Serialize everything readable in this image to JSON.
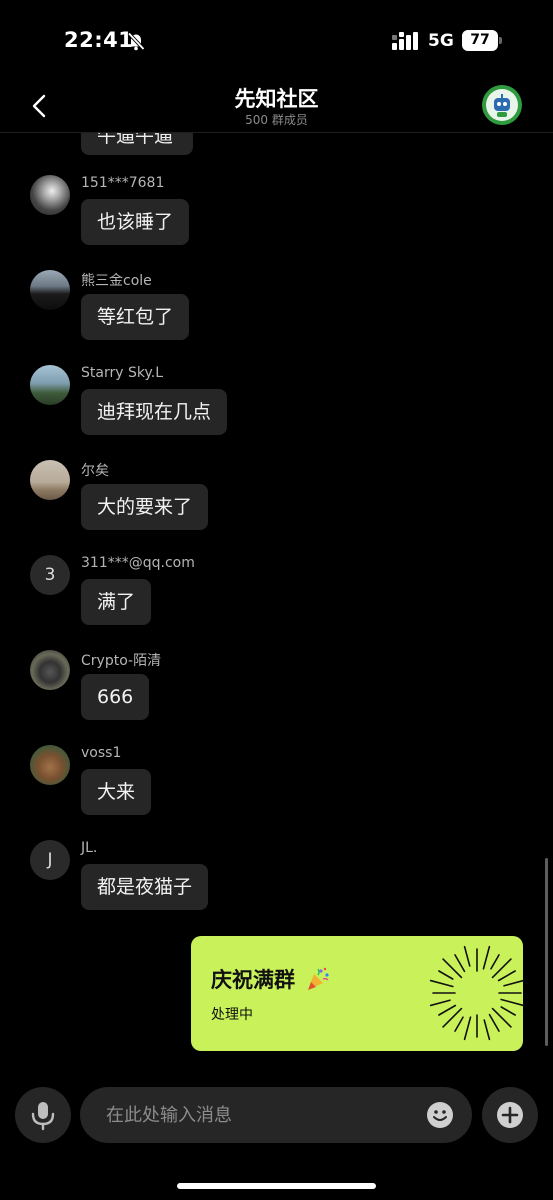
{
  "status_bar": {
    "time": "22:41",
    "network": "5G",
    "battery": "77"
  },
  "header": {
    "title": "先知社区",
    "subtitle": "500 群成员"
  },
  "partial_message": {
    "text": "牛逼牛逼"
  },
  "messages": [
    {
      "sender": "151***7681",
      "text": "也该睡了",
      "avatar": "photo"
    },
    {
      "sender": "熊三金cole",
      "text": "等红包了",
      "avatar": "photo"
    },
    {
      "sender": "Starry Sky.L",
      "text": "迪拜现在几点",
      "avatar": "photo"
    },
    {
      "sender": "尔矣",
      "text": "大的要来了",
      "avatar": "photo"
    },
    {
      "sender": "311***@qq.com",
      "text": "满了",
      "avatar_letter": "3"
    },
    {
      "sender": "Crypto-陌清",
      "text": "666",
      "avatar": "photo"
    },
    {
      "sender": "voss1",
      "text": "大来",
      "avatar": "photo"
    },
    {
      "sender": "JL.",
      "text": "都是夜猫子",
      "avatar_letter": "J"
    }
  ],
  "celebration": {
    "title": "庆祝满群",
    "status": "处理中"
  },
  "composer": {
    "placeholder": "在此处输入消息"
  },
  "colors": {
    "background": "#000000",
    "bubble": "#262626",
    "celebration": "#c9f25a"
  }
}
